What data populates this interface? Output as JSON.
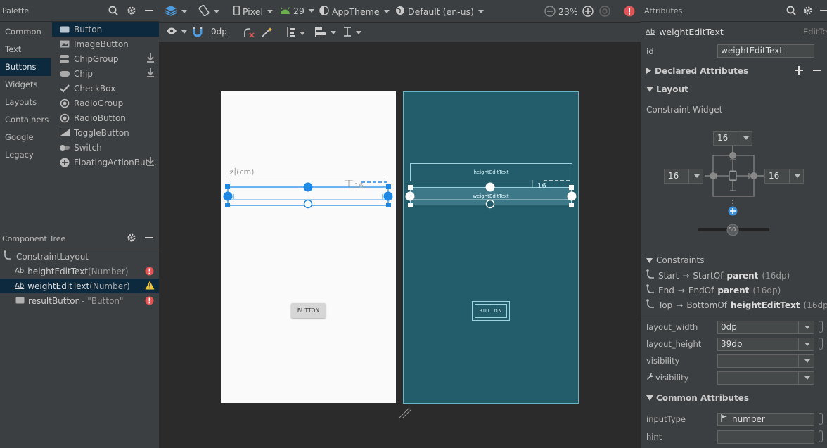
{
  "palette": {
    "title": "Palette",
    "categories": [
      "Common",
      "Text",
      "Buttons",
      "Widgets",
      "Layouts",
      "Containers",
      "Google",
      "Legacy"
    ],
    "selected_category": "Buttons",
    "items": [
      {
        "label": "Button",
        "icon": "button-icon"
      },
      {
        "label": "ImageButton",
        "icon": "image-button-icon"
      },
      {
        "label": "ChipGroup",
        "icon": "chip-group-icon",
        "download": true
      },
      {
        "label": "Chip",
        "icon": "chip-icon",
        "download": true
      },
      {
        "label": "CheckBox",
        "icon": "checkbox-icon"
      },
      {
        "label": "RadioGroup",
        "icon": "radio-group-icon"
      },
      {
        "label": "RadioButton",
        "icon": "radio-button-icon"
      },
      {
        "label": "ToggleButton",
        "icon": "toggle-button-icon"
      },
      {
        "label": "Switch",
        "icon": "switch-icon"
      },
      {
        "label": "FloatingActionBut...",
        "icon": "fab-icon",
        "download": true
      }
    ]
  },
  "component_tree": {
    "title": "Component Tree",
    "root": "ConstraintLayout",
    "nodes": [
      {
        "name": "heightEditText",
        "suffix": "(Number)",
        "status": "error"
      },
      {
        "name": "weightEditText",
        "suffix": "(Number)",
        "status": "warning",
        "selected": true
      },
      {
        "name": "resultButton",
        "suffix": "- \"Button\"",
        "status": "error"
      }
    ]
  },
  "toolbar": {
    "device": "Pixel",
    "api": "29",
    "theme": "AppTheme",
    "locale": "Default (en-us)",
    "zoom": "23%",
    "margin": "0dp"
  },
  "design": {
    "height_hint": "키(cm)",
    "height_label_blueprint": "heightEditText",
    "weight_label_blueprint": "weightEditText",
    "margin_label": "16",
    "button_text": "BUTTON"
  },
  "attributes": {
    "title": "Attributes",
    "component_name": "weightEditText",
    "component_type": "EditText",
    "id_label": "id",
    "id_value": "weightEditText",
    "declared_section": "Declared Attributes",
    "layout_section": "Layout",
    "constraint_widget": "Constraint Widget",
    "margins": {
      "top": "16",
      "left": "16",
      "right": "16"
    },
    "bias": "50",
    "constraints_title": "Constraints",
    "constraints": [
      {
        "side": "Start",
        "arrow": "→",
        "target": "StartOf",
        "anchor": "parent",
        "value": "(16dp)"
      },
      {
        "side": "End",
        "arrow": "→",
        "target": "EndOf",
        "anchor": "parent",
        "value": "(16dp)"
      },
      {
        "side": "Top",
        "arrow": "→",
        "target": "BottomOf",
        "anchor": "heightEditText",
        "value": "(16dp)"
      }
    ],
    "rows": [
      {
        "label": "layout_width",
        "value": "0dp"
      },
      {
        "label": "layout_height",
        "value": "39dp"
      },
      {
        "label": "visibility",
        "value": ""
      },
      {
        "label": "visibility",
        "value": ""
      }
    ],
    "common_section": "Common Attributes",
    "input_type_label": "inputType",
    "input_type_value": "number",
    "hint_label": "hint",
    "hint_value": ""
  },
  "colors": {
    "accent": "#1e88e5",
    "blueprint": "#235c6a",
    "selection": "#0d293e",
    "error": "#e05555",
    "warning": "#f0c33c"
  }
}
